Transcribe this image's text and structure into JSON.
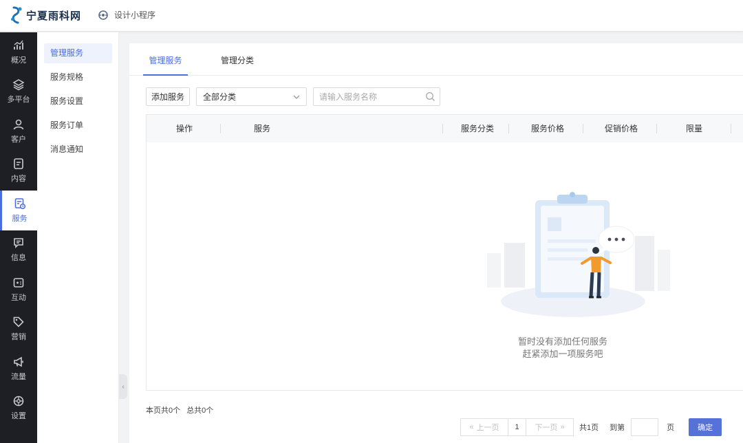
{
  "header": {
    "brand": "宁夏雨科网",
    "mini_app_label": "设计小程序"
  },
  "leftnav": [
    {
      "label": "概况",
      "icon": "chart-icon",
      "active": false
    },
    {
      "label": "多平台",
      "icon": "layers-icon",
      "active": false
    },
    {
      "label": "客户",
      "icon": "user-icon",
      "active": false
    },
    {
      "label": "内容",
      "icon": "document-icon",
      "active": false
    },
    {
      "label": "服务",
      "icon": "service-icon",
      "active": true
    },
    {
      "label": "信息",
      "icon": "message-icon",
      "active": false
    },
    {
      "label": "互动",
      "icon": "gamepad-icon",
      "active": false
    },
    {
      "label": "营销",
      "icon": "tag-icon",
      "active": false
    },
    {
      "label": "流量",
      "icon": "megaphone-icon",
      "active": false
    },
    {
      "label": "设置",
      "icon": "gear-icon",
      "active": false
    }
  ],
  "subnav": [
    "管理服务",
    "服务规格",
    "服务设置",
    "服务订单",
    "消息通知"
  ],
  "tabs": [
    "管理服务",
    "管理分类"
  ],
  "toolbar": {
    "add_button": "添加服务",
    "category_select": "全部分类",
    "search_placeholder": "请输入服务名称"
  },
  "table": {
    "columns": [
      "操作",
      "服务",
      "服务分类",
      "服务价格",
      "促销价格",
      "限量"
    ]
  },
  "empty": {
    "line1": "暂时没有添加任何服务",
    "line2": "赶紧添加一项服务吧"
  },
  "footer": {
    "page_info": "本页共0个",
    "total_info": "总共0个",
    "prev": "上一页",
    "current_page": "1",
    "next": "下一页",
    "total_pages": "共1页",
    "goto": "到第",
    "unit": "页",
    "confirm": "确定"
  },
  "colors": {
    "accent": "#4a6ee0",
    "nav_bg": "#1e1f24",
    "confirm_bg": "#5672d8"
  }
}
